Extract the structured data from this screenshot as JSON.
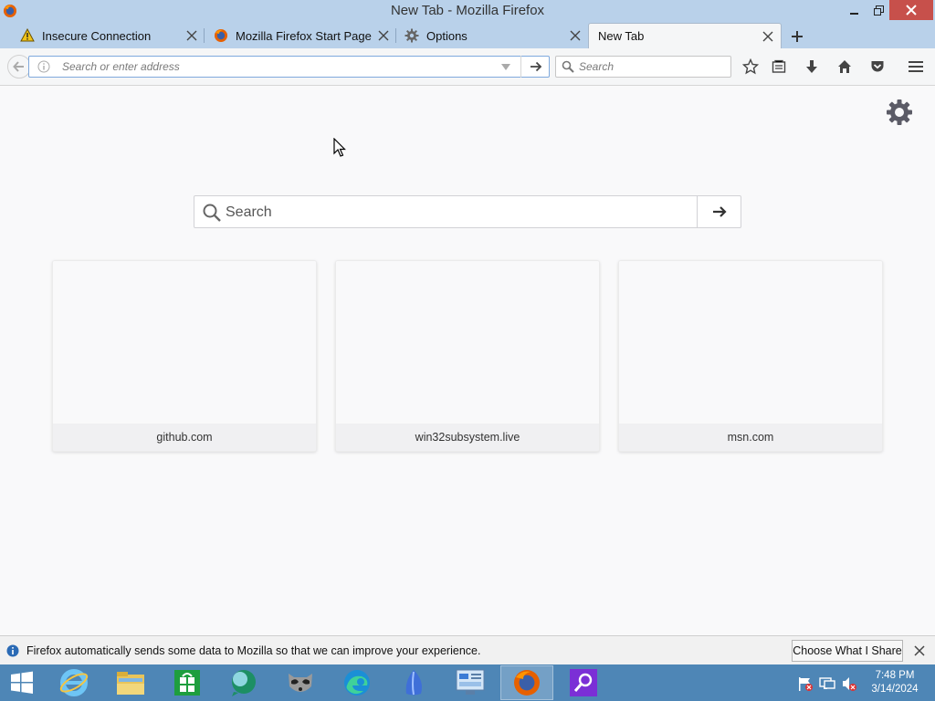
{
  "window": {
    "title": "New Tab - Mozilla Firefox"
  },
  "tabs": [
    {
      "label": "Insecure Connection",
      "icon": "warning-icon"
    },
    {
      "label": "Mozilla Firefox Start Page",
      "icon": "firefox-icon"
    },
    {
      "label": "Options",
      "icon": "gear-icon"
    },
    {
      "label": "New Tab",
      "icon": "",
      "active": true
    }
  ],
  "navbar": {
    "url_placeholder": "Search or enter address",
    "search_placeholder": "Search"
  },
  "content": {
    "search_placeholder": "Search",
    "tiles": [
      {
        "label": "github.com"
      },
      {
        "label": "win32subsystem.live"
      },
      {
        "label": "msn.com"
      }
    ]
  },
  "notification": {
    "message": "Firefox automatically sends some data to Mozilla so that we can improve your experience.",
    "button_label": "Choose What I Share"
  },
  "taskbar": {
    "items": [
      "start-button",
      "internet-explorer-icon",
      "file-explorer-icon",
      "store-icon",
      "app-bubble-icon",
      "raccoon-app-icon",
      "edge-icon",
      "app-leaf-icon",
      "control-panel-icon",
      "firefox-icon",
      "search-app-icon"
    ],
    "time": "7:48 PM",
    "date": "3/14/2024"
  },
  "colors": {
    "titlebar": "#b9d1ea",
    "close_button": "#c7504b",
    "taskbar": "#4e86b6",
    "url_focus": "#7fa9dd"
  }
}
